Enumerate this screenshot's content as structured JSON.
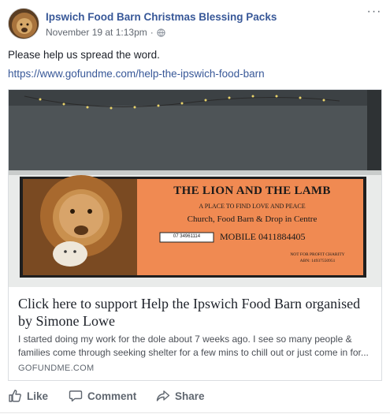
{
  "post": {
    "page_name": "Ipswich Food Barn Christmas Blessing Packs",
    "timestamp": "November 19 at 1:13pm",
    "separator": "·",
    "privacy_icon": "globe-icon",
    "more_label": "···",
    "message": "Please help us spread the word.",
    "link_url": "https://www.gofundme.com/help-the-ipswich-food-barn"
  },
  "card": {
    "sign": {
      "title": "THE LION AND THE LAMB",
      "tagline": "A PLACE TO FIND LOVE AND PEACE",
      "line2": "Church, Food Barn & Drop in Centre",
      "phone_small": "07 34961114",
      "mobile": "MOBILE 0411884405",
      "charity": "NOT FOR PROFIT CHARITY",
      "abn": "ABN: 14937550951"
    },
    "title": "Click here to support Help the Ipswich Food Barn organised by Simone Lowe",
    "description": "I started doing my work for the dole about 7 weeks ago. I see so many people & families come through seeking shelter for a few mins to chill out or just come in for...",
    "domain": "GOFUNDME.COM"
  },
  "actions": {
    "like": "Like",
    "comment": "Comment",
    "share": "Share"
  },
  "colors": {
    "link_blue": "#385898",
    "sign_orange": "#f08a52",
    "action_gray": "#606770"
  }
}
